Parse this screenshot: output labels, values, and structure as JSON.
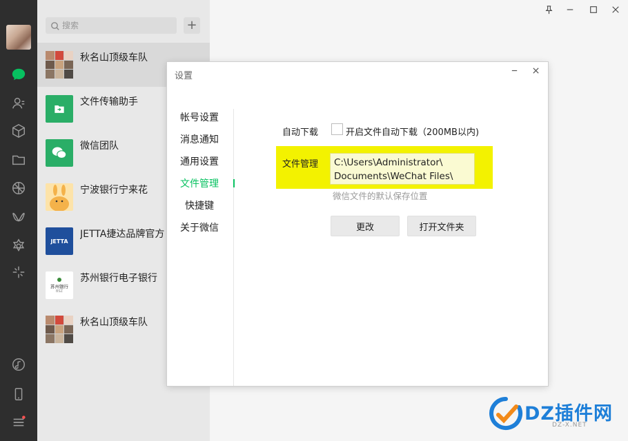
{
  "search": {
    "placeholder": "搜索"
  },
  "add_button": "+",
  "chats": [
    {
      "name": "秋名山顶级车队",
      "avatar": "group-collage"
    },
    {
      "name": "文件传输助手",
      "avatar": "file-transfer",
      "color": "#2aae67"
    },
    {
      "name": "微信团队",
      "avatar": "wechat-team",
      "color": "#2aae67"
    },
    {
      "name": "宁波银行宁来花",
      "avatar": "cartoon-rabbit"
    },
    {
      "name": "JETTA捷达品牌官方",
      "avatar": "jetta-logo",
      "logo_text": "JETTA",
      "color": "#1f4f9c"
    },
    {
      "name": "苏州银行电子银行",
      "avatar": "bank-of-suzhou-logo",
      "logo_text": "苏州银行",
      "logo_sub": "BSZ"
    },
    {
      "name": "秋名山顶级车队",
      "avatar": "group-collage"
    }
  ],
  "dialog": {
    "title": "设置",
    "nav": [
      {
        "label": "帐号设置"
      },
      {
        "label": "消息通知"
      },
      {
        "label": "通用设置"
      },
      {
        "label": "文件管理",
        "active": true
      },
      {
        "label": "快捷键"
      },
      {
        "label": "关于微信"
      }
    ],
    "auto_download": {
      "label": "自动下载",
      "checkbox_label": "开启文件自动下载（200MB以内)",
      "checked": false
    },
    "file_management": {
      "label": "文件管理",
      "path_line1": "C:\\Users\\Administrator\\",
      "path_line2": "Documents\\WeChat Files\\",
      "description": "微信文件的默认保存位置",
      "highlight_color": "#f3f200"
    },
    "buttons": {
      "change": "更改",
      "open_folder": "打开文件夹"
    }
  },
  "watermark": {
    "text": "DZ插件网",
    "sub": "DZ-X.NET"
  },
  "colors": {
    "accent": "#07c160",
    "sidebar": "#2e2e2e"
  }
}
